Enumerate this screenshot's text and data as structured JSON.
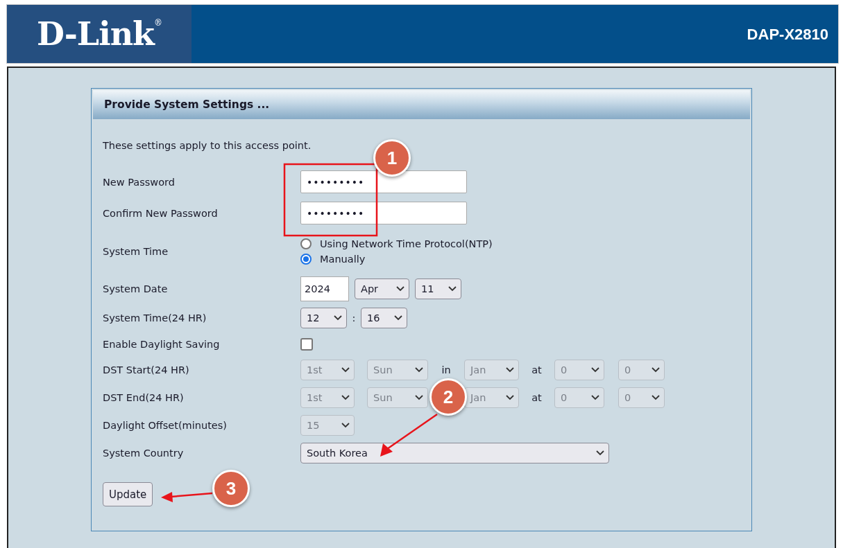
{
  "header": {
    "logo": "D-Link$^{®}$",
    "model": "DAP-X2810"
  },
  "panel": {
    "title": "Provide System Settings ...",
    "intro": "These settings apply to this access point.",
    "password_fields": [
      {
        "label": "New Password",
        "value": "•••••••••"
      },
      {
        "label": "Confirm New Password",
        "value": "•••••••••"
      }
    ],
    "system_time": {
      "label": "System Time",
      "options": [
        {
          "label": "Using Network Time Protocol(NTP)",
          "selected": false
        },
        {
          "label": "Manually",
          "selected": true
        }
      ]
    },
    "system_date": {
      "label": "System Date",
      "year": "2024",
      "month": "Apr",
      "day": "11"
    },
    "system_time_24": {
      "label": "System Time(24 HR)",
      "hour": "12",
      "separator": ":",
      "minute": "16"
    },
    "daylight_saving": {
      "label": "Enable Daylight Saving",
      "checked": false
    },
    "dst_rows": [
      {
        "label": "DST Start(24 HR)",
        "disabled": true,
        "week": "1st",
        "day": "Sun",
        "in_text": "in",
        "month": "Jan",
        "at_text": "at",
        "hour": "0",
        "minute": "0"
      },
      {
        "label": "DST End(24 HR)",
        "disabled": true,
        "week": "1st",
        "day": "Sun",
        "month": "Jan",
        "at_text": "at",
        "hour": "0",
        "minute": "0"
      }
    ],
    "offset": {
      "label": "Daylight Offset(minutes)",
      "disabled": true,
      "value": "15"
    },
    "country": {
      "label": "System Country",
      "value": "South Korea"
    },
    "update_button": "Update"
  },
  "annotations": [
    {
      "number": "1"
    },
    {
      "number": "2"
    },
    {
      "number": "3"
    }
  ]
}
